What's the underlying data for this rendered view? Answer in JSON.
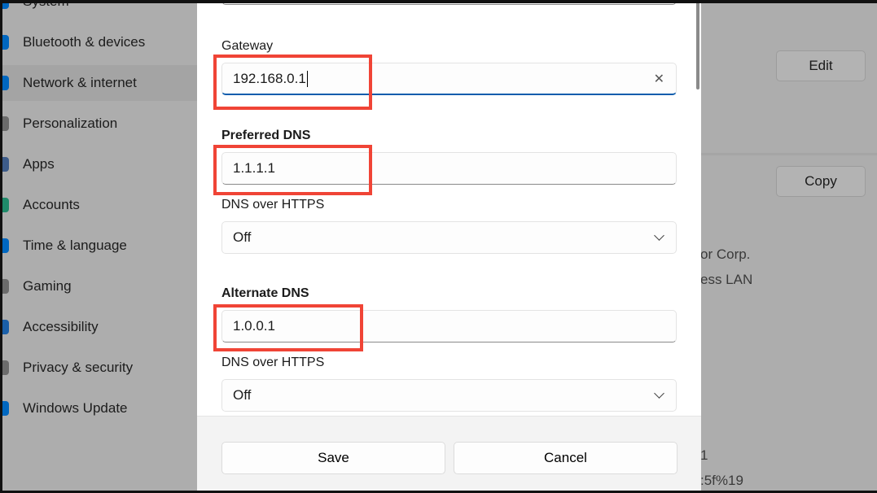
{
  "sidebar": {
    "items": [
      {
        "label": "System",
        "icon": "system-icon",
        "color": "#0067c0"
      },
      {
        "label": "Bluetooth & devices",
        "icon": "bluetooth-icon",
        "color": "#0067c0"
      },
      {
        "label": "Network & internet",
        "icon": "network-icon",
        "color": "#0067c0",
        "active": true
      },
      {
        "label": "Personalization",
        "icon": "brush-icon",
        "color": "#6b6b6b"
      },
      {
        "label": "Apps",
        "icon": "apps-icon",
        "color": "#3d5c8a"
      },
      {
        "label": "Accounts",
        "icon": "accounts-icon",
        "color": "#1f8a6a"
      },
      {
        "label": "Time & language",
        "icon": "globe-icon",
        "color": "#0067c0"
      },
      {
        "label": "Gaming",
        "icon": "gaming-icon",
        "color": "#6b6b6b"
      },
      {
        "label": "Accessibility",
        "icon": "accessibility-icon",
        "color": "#1a5fa8"
      },
      {
        "label": "Privacy & security",
        "icon": "shield-icon",
        "color": "#6b6b6b"
      },
      {
        "label": "Windows Update",
        "icon": "update-icon",
        "color": "#0067c0"
      }
    ]
  },
  "right": {
    "edit": "Edit",
    "copy": "Copy",
    "text1": "or Corp.",
    "text2": "ess LAN",
    "text3": "1",
    "text4": ":5f%19"
  },
  "dialog": {
    "gateway_label": "Gateway",
    "gateway_value": "192.168.0.1",
    "preferred_label": "Preferred DNS",
    "preferred_value": "1.1.1.1",
    "doh1_label": "DNS over HTTPS",
    "doh1_value": "Off",
    "alternate_label": "Alternate DNS",
    "alternate_value": "1.0.0.1",
    "doh2_label": "DNS over HTTPS",
    "doh2_value": "Off",
    "save": "Save",
    "cancel": "Cancel",
    "highlight_color": "#f04436"
  }
}
